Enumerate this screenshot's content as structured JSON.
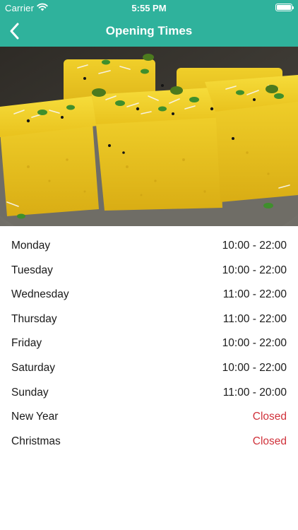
{
  "status_bar": {
    "carrier": "Carrier",
    "time": "5:55 PM",
    "wifi_icon": "wifi-icon",
    "battery_icon": "battery-icon"
  },
  "nav": {
    "title": "Opening Times",
    "back_icon": "chevron-left-icon"
  },
  "colors": {
    "header": "#2fb29c",
    "closed": "#d0323b",
    "text": "#1a1a1a"
  },
  "schedule": [
    {
      "day": "Monday",
      "hours": "10:00 - 22:00",
      "closed": false
    },
    {
      "day": "Tuesday",
      "hours": "10:00 - 22:00",
      "closed": false
    },
    {
      "day": "Wednesday",
      "hours": "11:00 - 22:00",
      "closed": false
    },
    {
      "day": "Thursday",
      "hours": "11:00 - 22:00",
      "closed": false
    },
    {
      "day": "Friday",
      "hours": "10:00 - 22:00",
      "closed": false
    },
    {
      "day": "Saturday",
      "hours": "10:00 - 22:00",
      "closed": false
    },
    {
      "day": "Sunday",
      "hours": "11:00 - 20:00",
      "closed": false
    },
    {
      "day": "New Year",
      "hours": "Closed",
      "closed": true
    },
    {
      "day": "Christmas",
      "hours": "Closed",
      "closed": true
    }
  ]
}
